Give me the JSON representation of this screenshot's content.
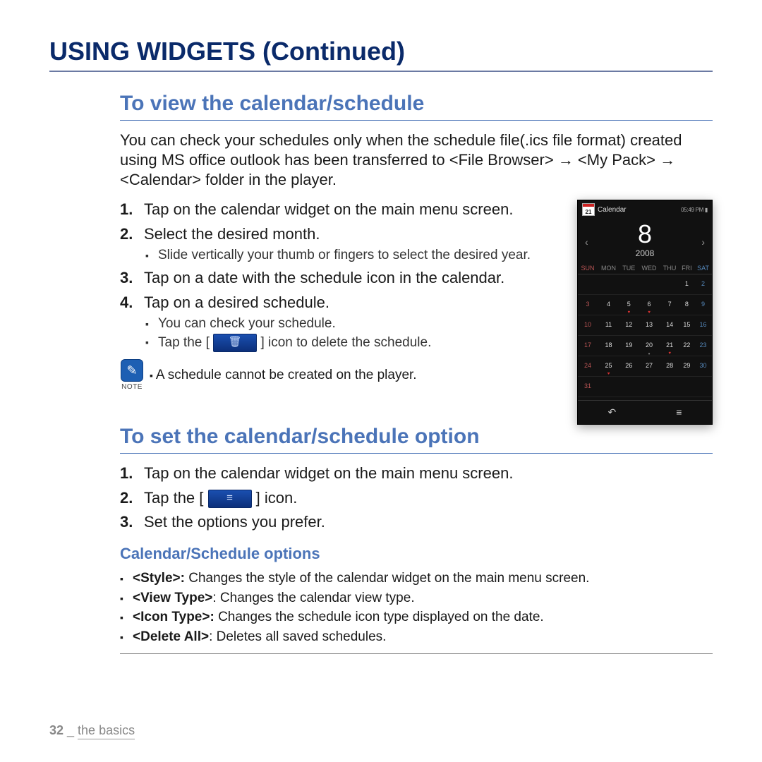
{
  "h1": "USING WIDGETS (Continued)",
  "section1": {
    "title": "To view the calendar/schedule",
    "intro": "You can check your schedules only when the schedule file(.ics file format) created using MS office outlook has been transferred to <File Browser> → <My Pack> → <Calendar> folder in the player.",
    "steps": [
      {
        "num": "1.",
        "text": "Tap on the calendar widget on the main menu screen."
      },
      {
        "num": "2.",
        "text": "Select the desired month.",
        "sub": [
          "Slide vertically your thumb or fingers to select the desired year."
        ]
      },
      {
        "num": "3.",
        "text": "Tap on a date with the schedule icon in the calendar."
      },
      {
        "num": "4.",
        "text": "Tap on a desired schedule.",
        "sub": [
          "You can check your schedule."
        ]
      }
    ],
    "delete_pre": "Tap the [ ",
    "delete_post": " ] icon to delete the schedule.",
    "note_label": "NOTE",
    "note_text": "A schedule cannot be created on the player."
  },
  "section2": {
    "title": "To set the calendar/schedule option",
    "steps": [
      {
        "num": "1.",
        "text": "Tap on the calendar widget on the main menu screen."
      },
      {
        "num": "2.",
        "pre": "Tap the [ ",
        "post": " ] icon."
      },
      {
        "num": "3.",
        "text": "Set the options you prefer."
      }
    ],
    "opts_title": "Calendar/Schedule options",
    "opts": [
      {
        "label": "<Style>: ",
        "text": "Changes the style of the calendar widget on the main menu screen."
      },
      {
        "label": "<View Type>",
        "text": ": Changes the calendar view type."
      },
      {
        "label": "<Icon Type>: ",
        "text": "Changes the schedule icon type displayed on the date."
      },
      {
        "label": "<Delete All>",
        "text": ": Deletes all saved schedules."
      }
    ]
  },
  "footer": {
    "page": "32",
    "sep": " _ ",
    "section": "the basics"
  },
  "device": {
    "cal_icon_day": "21",
    "label": "Calendar",
    "status": "05:49 PM ▮",
    "month": "8",
    "year": "2008",
    "dow": [
      "SUN",
      "MON",
      "TUE",
      "WED",
      "THU",
      "FRI",
      "SAT"
    ],
    "weeks": [
      [
        "",
        "",
        "",
        "",
        "",
        "1",
        "2"
      ],
      [
        "3",
        "4",
        "5",
        "6",
        "7",
        "8",
        "9"
      ],
      [
        "10",
        "11",
        "12",
        "13",
        "14",
        "15",
        "16"
      ],
      [
        "17",
        "18",
        "19",
        "20",
        "21",
        "22",
        "23"
      ],
      [
        "24",
        "25",
        "26",
        "27",
        "28",
        "29",
        "30"
      ],
      [
        "31",
        "",
        "",
        "",
        "",
        "",
        ""
      ]
    ],
    "hearts": [
      [
        1,
        2
      ],
      [
        1,
        3
      ],
      [
        3,
        4
      ],
      [
        4,
        1
      ]
    ],
    "events": [
      [
        3,
        3
      ]
    ],
    "back_glyph": "↶",
    "menu_glyph": "≡"
  },
  "icons": {
    "trash": "🗑",
    "menu": "≡",
    "pencil": "✎"
  }
}
